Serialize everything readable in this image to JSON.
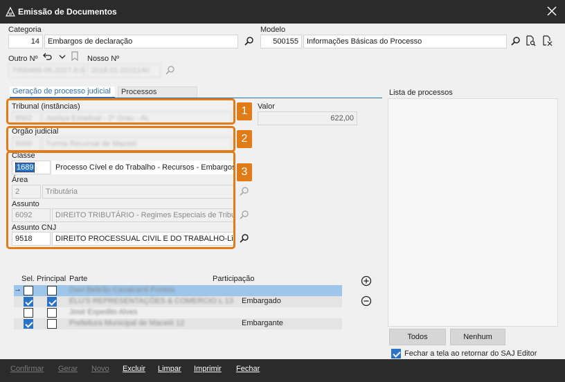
{
  "window": {
    "title": "Emissão de Documentos"
  },
  "categoria": {
    "label": "Categoria",
    "code": "14",
    "name": "Embargos de declaração"
  },
  "modelo": {
    "label": "Modelo",
    "code": "500155",
    "name": "Informações Básicas do Processo"
  },
  "outro_numero": {
    "label": "Outro Nº",
    "value": "7000489-05.2017.8.02.0001"
  },
  "nosso_numero": {
    "label": "Nosso Nº",
    "value": "2018.01.0101140"
  },
  "tabs": [
    {
      "label": "Geração de processo judicial"
    },
    {
      "label": "Processos vinculados"
    }
  ],
  "tribunal": {
    "label": "Tribunal (instâncias)",
    "code": "8502",
    "name": "Justiça Estadual - 2º Grau - AL"
  },
  "orgao": {
    "label": "Órgão judicial",
    "code": "9000",
    "name": "Turma Recursal de Maceió"
  },
  "valor": {
    "label": "Valor",
    "value": "622,00"
  },
  "classe": {
    "label": "Classe",
    "code": "1689",
    "name": "Processo Cível e do Trabalho - Recursos - Embargos"
  },
  "area": {
    "label": "Área",
    "code": "2",
    "name": "Tributária"
  },
  "assunto": {
    "label": "Assunto",
    "code": "6092",
    "name": "DIREITO TRIBUTÁRIO - Regimes Especiais de Tribut"
  },
  "assunto_cnj": {
    "label": "Assunto CNJ",
    "code": "9518",
    "name": "DIREITO PROCESSUAL CIVIL E DO TRABALHO-Liquid"
  },
  "callouts": [
    "1",
    "2",
    "3"
  ],
  "parties": {
    "headers": {
      "sel": "Sel.",
      "principal": "Principal",
      "parte": "Parte",
      "participacao": "Participação"
    },
    "rows": [
      {
        "sel": false,
        "principal": false,
        "parte": "Davi Beltrão Cavalcanti Portela",
        "participacao": "",
        "current": true
      },
      {
        "sel": true,
        "principal": true,
        "parte": "ELU'S REPRESENTAÇÕES & COMERCIO L 13",
        "participacao": "Embargado",
        "current": false
      },
      {
        "sel": false,
        "principal": false,
        "parte": "José Expedito Alves",
        "participacao": "",
        "current": false
      },
      {
        "sel": true,
        "principal": false,
        "parte": "Prefeitura Municipal de Maceió 12",
        "participacao": "Embargante",
        "current": false
      }
    ]
  },
  "lista": {
    "label": "Lista de processos"
  },
  "todos_button": "Todos",
  "nenhum_button": "Nenhum",
  "fechar_checkbox": {
    "label": "Fechar a tela ao retornar do SAJ Editor",
    "checked": true
  },
  "footer": {
    "confirmar": "Confirmar",
    "gerar": "Gerar",
    "novo": "Novo",
    "excluir": "Excluir",
    "limpar": "Limpar",
    "imprimir": "Imprimir",
    "fechar": "Fechar"
  },
  "colors": {
    "accent": "#2a6fb5",
    "callout": "#e07b17",
    "titlebar": "#2b2b2b",
    "selection": "#9ec6ea"
  },
  "icons": [
    "app-icon",
    "close-icon",
    "search-icon",
    "undo-icon",
    "chevron-down-icon",
    "bookmark-icon",
    "add-circle-icon",
    "remove-circle-icon",
    "row-pointer-icon"
  ]
}
